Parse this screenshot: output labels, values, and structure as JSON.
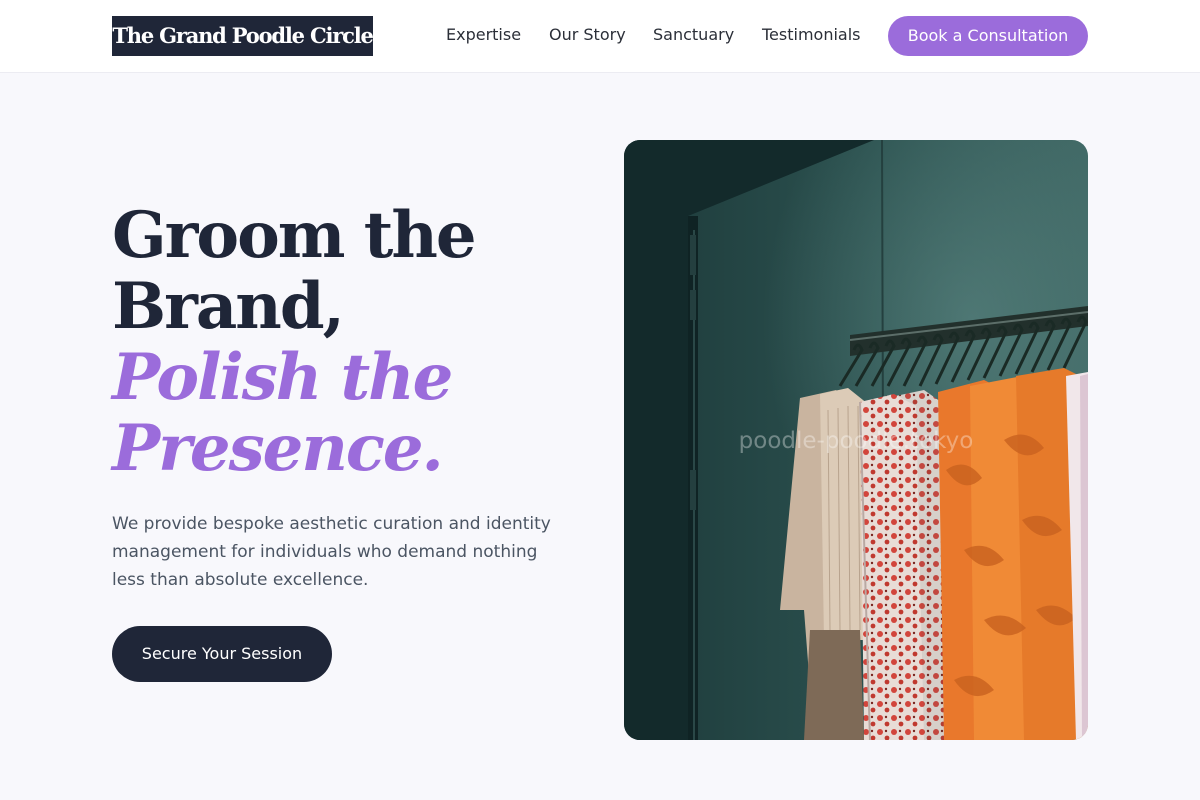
{
  "header": {
    "logo": "The Grand Poodle Circle",
    "nav": [
      "Expertise",
      "Our Story",
      "Sanctuary",
      "Testimonials"
    ],
    "cta": "Book a Consultation"
  },
  "hero": {
    "headline_lines": [
      "Groom the",
      "Brand,"
    ],
    "headline_accent_lines": [
      "Polish the",
      "Presence."
    ],
    "subtext": "We provide bespoke aesthetic curation and identity management for individuals who demand nothing less than absolute excellence.",
    "cta": "Secure Your Session",
    "image_watermark": "poodle-poodle.tokyo"
  },
  "colors": {
    "accent": "#9b6cdb",
    "navy": "#1f2638",
    "background": "#f8f8fc"
  }
}
